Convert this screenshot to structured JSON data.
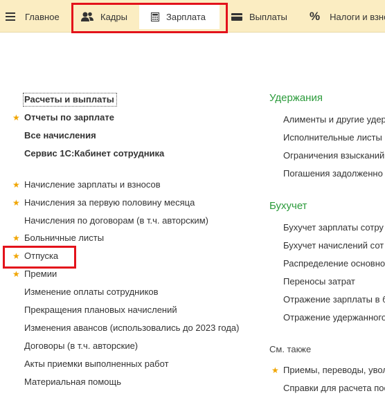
{
  "topbar": {
    "tabs": [
      {
        "label": "Главное",
        "icon": "hamburger-icon"
      },
      {
        "label": "Кадры",
        "icon": "users-icon"
      },
      {
        "label": "Зарплата",
        "icon": "calculator-icon"
      },
      {
        "label": "Выплаты",
        "icon": "wallet-icon"
      },
      {
        "label": "Налоги и взносы",
        "icon": "percent-icon",
        "symbol": "%"
      }
    ],
    "highlight_color": "#e3121b",
    "background": "#fbedc2"
  },
  "left": {
    "main_links": [
      {
        "label": "Расчеты и выплаты",
        "starred": false
      },
      {
        "label": "Отчеты по зарплате",
        "starred": true
      },
      {
        "label": "Все начисления",
        "starred": false
      },
      {
        "label": "Сервис 1С:Кабинет сотрудника",
        "starred": false
      }
    ],
    "items": [
      {
        "label": "Начисление зарплаты и взносов",
        "starred": true
      },
      {
        "label": "Начисления за первую половину месяца",
        "starred": true
      },
      {
        "label": "Начисления по договорам (в т.ч. авторским)",
        "starred": false
      },
      {
        "label": "Больничные листы",
        "starred": true
      },
      {
        "label": "Отпуска",
        "starred": true
      },
      {
        "label": "Премии",
        "starred": true
      },
      {
        "label": "Изменение оплаты сотрудников",
        "starred": false
      },
      {
        "label": "Прекращения плановых начислений",
        "starred": false
      },
      {
        "label": "Изменения авансов (использовались до 2023 года)",
        "starred": false
      },
      {
        "label": "Договоры (в т.ч. авторские)",
        "starred": false
      },
      {
        "label": "Акты приемки выполненных работ",
        "starred": false
      },
      {
        "label": "Материальная помощь",
        "starred": false
      }
    ]
  },
  "right": {
    "sections": [
      {
        "title": "Удержания",
        "items": [
          "Алименты и другие удер",
          "Исполнительные листы",
          "Ограничения взысканий",
          "Погашения задолженно"
        ]
      },
      {
        "title": "Бухучет",
        "items": [
          "Бухучет зарплаты сотру",
          "Бухучет начислений сот",
          "Распределение основно",
          "Переносы затрат",
          "Отражение зарплаты в б",
          "Отражение удержанного"
        ]
      }
    ],
    "see_also": {
      "label": "См. также",
      "items": [
        {
          "label": "Приемы, переводы, увол",
          "starred": true
        },
        {
          "label": "Справки для расчета пос",
          "starred": false
        }
      ]
    }
  },
  "colors": {
    "star": "#f0a500",
    "section": "#2a9a3a"
  }
}
